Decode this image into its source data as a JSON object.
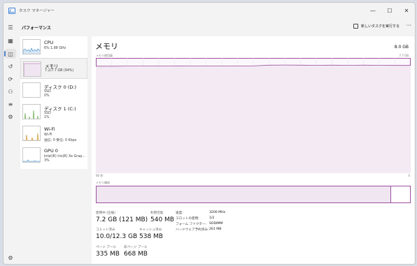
{
  "window": {
    "title": "タスク マネージャー",
    "controls": {
      "minimize": "—",
      "maximize": "☐",
      "close": "✕"
    }
  },
  "nav": {
    "items": [
      {
        "name": "menu-icon",
        "glyph": "☰"
      },
      {
        "name": "processes-icon",
        "glyph": "▦"
      },
      {
        "name": "performance-icon",
        "glyph": "◫"
      },
      {
        "name": "history-icon",
        "glyph": "↺"
      },
      {
        "name": "startup-icon",
        "glyph": "⟳"
      },
      {
        "name": "users-icon",
        "glyph": "⚇"
      },
      {
        "name": "details-icon",
        "glyph": "≡"
      },
      {
        "name": "services-icon",
        "glyph": "⚙"
      }
    ],
    "settings_glyph": "⚙"
  },
  "header": {
    "title": "パフォーマンス",
    "run_task": "新しいタスクを実行する",
    "more": "···"
  },
  "devices": [
    {
      "name": "CPU",
      "lines": [
        "6% 1.88 GHz"
      ]
    },
    {
      "name": "メモリ",
      "lines": [
        "7.2/7.7 GB (94%)"
      ]
    },
    {
      "name": "ディスク 0 (D:)",
      "lines": [
        "SSD",
        "0%"
      ]
    },
    {
      "name": "ディスク 1 (C:)",
      "lines": [
        "SSD",
        "1%"
      ]
    },
    {
      "name": "Wi-Fi",
      "lines": [
        "Wi-Fi",
        "送信: 0 受信: 0 Kbps"
      ]
    },
    {
      "name": "GPU 0",
      "lines": [
        "Intel(R) Iris(R) Xe Grap...",
        "3%"
      ]
    }
  ],
  "main": {
    "title": "メモリ",
    "total": "8.0 GB",
    "usage_label": "メモリ使用量",
    "usage_max": "7.7 GB",
    "axis_left": "60 秒",
    "axis_right": "0",
    "composition_label": "メモリ構成",
    "composition_used_fraction": 0.94,
    "stats": {
      "in_use_label": "使用中 (圧縮)",
      "in_use_value": "7.2 GB (121 MB)",
      "available_label": "利用可能",
      "available_value": "540 MB",
      "committed_label": "コミット済み",
      "committed_value": "10.0/12.3 GB",
      "cached_label": "キャッシュ済み",
      "cached_value": "538 MB",
      "paged_label": "ページ プール",
      "paged_value": "335 MB",
      "nonpaged_label": "非ページ プール",
      "nonpaged_value": "668 MB"
    },
    "specs": [
      {
        "k": "速度:",
        "v": "3200 MHz"
      },
      {
        "k": "スロットの使用:",
        "v": "1/2"
      },
      {
        "k": "フォーム ファクター:",
        "v": "SODIMM"
      },
      {
        "k": "ハードウェア予約済み:",
        "v": "261 MB"
      }
    ]
  },
  "chart_data": {
    "type": "area",
    "title": "メモリ使用量",
    "ylim": [
      0,
      7.7
    ],
    "x": [
      60,
      57,
      54,
      51,
      48,
      45,
      42,
      39,
      36,
      33,
      30,
      27,
      24,
      21,
      18,
      15,
      12,
      9,
      6,
      3,
      0
    ],
    "values": [
      7.15,
      7.15,
      7.16,
      7.16,
      7.17,
      7.17,
      7.16,
      7.17,
      7.17,
      7.17,
      7.17,
      7.22,
      7.23,
      7.22,
      7.21,
      7.22,
      7.21,
      7.22,
      7.21,
      7.2,
      7.2
    ],
    "grid": true,
    "color": "#9b4fa0"
  }
}
